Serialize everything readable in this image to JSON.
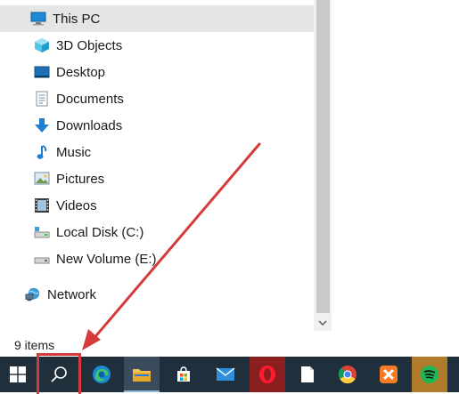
{
  "navigation": {
    "this_pc": "This PC",
    "items": [
      {
        "label": "3D Objects",
        "icon": "3d-objects-icon"
      },
      {
        "label": "Desktop",
        "icon": "desktop-icon"
      },
      {
        "label": "Documents",
        "icon": "documents-icon"
      },
      {
        "label": "Downloads",
        "icon": "downloads-icon"
      },
      {
        "label": "Music",
        "icon": "music-icon"
      },
      {
        "label": "Pictures",
        "icon": "pictures-icon"
      },
      {
        "label": "Videos",
        "icon": "videos-icon"
      },
      {
        "label": "Local Disk (C:)",
        "icon": "drive-icon"
      },
      {
        "label": "New Volume (E:)",
        "icon": "drive-icon"
      }
    ],
    "network": "Network"
  },
  "status": {
    "item_count": "9 items"
  },
  "taskbar": {
    "apps": [
      "start",
      "search",
      "edge",
      "file-explorer",
      "store",
      "mail",
      "opera",
      "notepad",
      "chrome",
      "xampp",
      "spotify"
    ]
  },
  "colors": {
    "accent": "#0078d7",
    "selection": "#e5e5e5",
    "taskbar": "#1f2f3c",
    "annotation": "#d63b3b"
  }
}
